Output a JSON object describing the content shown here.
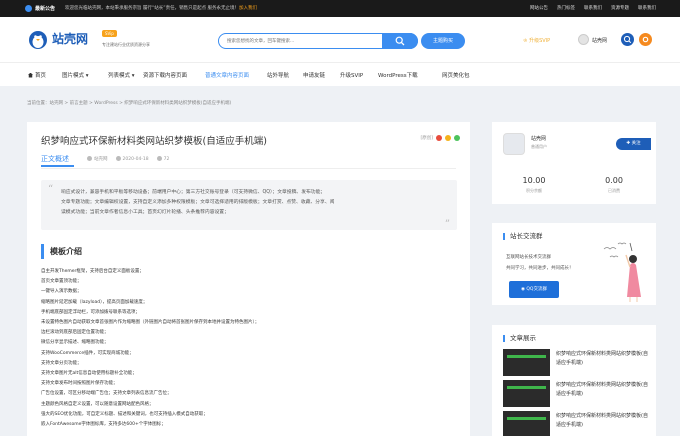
{
  "topbar": {
    "latest": "最新公告",
    "notice": "欢迎您光临站壳网，本站秉承服务宗旨 履行“站长”责任，销售只是起点 服务永无止境！",
    "notice_link": "加入我们",
    "links": [
      "网站公告",
      "热门标签",
      "联系我们",
      "资源专题",
      "联系我们"
    ]
  },
  "header": {
    "logo_text": "站壳网",
    "logo_badge": "SVip",
    "logo_sub": "专注建站行业优质资源分享",
    "search_placeholder": "搜索您想找的文章，回车键搜索...",
    "buy_button": "主题购买",
    "vip_label": "升级SVIP",
    "user_name": "站壳网"
  },
  "nav": {
    "items": [
      "首页",
      "图片模式",
      "列表模式",
      "资源下载内容页面",
      "普通文章内容页面",
      "站外导航",
      "申请友链",
      "升级SVIP",
      "WordPress下载",
      "网页美化包"
    ],
    "active_index": 4
  },
  "breadcrumb": "当前位置：站壳网 > 前言主题 > WordPress > 织梦响应式环保新材料类网站织梦模板(自适应手机端)",
  "article": {
    "title": "织梦响应式环保新材料类网站织梦模板(自适应手机端)",
    "badge": "[原创]",
    "tab": "正文概述",
    "author": "站壳网",
    "date": "2020-04-18",
    "views": "72",
    "quote_text_parts": [
      "响应式设计，兼容手机和平板等移动设备；前端用户中心；第三方社交账号登录（可支持微信、QQ）；文章投稿、发布功能；",
      "文章专题功能；文章编辑权设置，支持自定义添加多种权限模板；文章可选择适用的排版模板；文章打赏、点赞、收藏、分享、阅",
      "读模式功能；当前文章作者信息小工具；首页幻灯片轮播、头条推荐内容设置；"
    ],
    "section_title": "模板介绍",
    "lines": [
      "自主开发Themer框架，支持后台自定义面板设置；",
      "首页文章置顶功能；",
      "一键导入演示数据；",
      "缩略图片延迟加载（lazyload），提高页面加载速度；",
      "手机端底部固定浮动栏，可添加拨号联系等选项；",
      "未设置特色图片自动获取文章首张图片作为缩略图（外链图片自动将首张图片保存到本地并设置为特色图片）；",
      "边栏滚动到底部后固定位置功能；",
      "微信分享显示描述、缩略图功能；",
      "支持WooCommerce插件，可实现商城功能；",
      "支持文章分页功能；",
      "支持文章图片无alt信息自动使用标题补全功能；",
      "支持文章发布时间按照图片保存功能；",
      "广告位设置，可区分移动端广告位；支持文章列表信息流广告位；",
      "主题颜色风格自定义设置，可以随意设置网站配色风格；",
      "强大的SEO优化功能，可自定义标题、描述和关键词，也可支持插入模式自动获取；",
      "嵌入FontAwesome字体图标库，支持多达600+个字体图标；"
    ]
  },
  "sidebar": {
    "profile": {
      "name": "站壳网",
      "role": "普通用户",
      "follow": "关注",
      "stats": [
        {
          "num": "10.00",
          "label": "积分余额"
        },
        {
          "num": "0.00",
          "label": "已消费"
        }
      ]
    },
    "group": {
      "title": "站长交流群",
      "line1": "互联网站长技术交流群",
      "line2": "共同学习，共同进步，共同成长！",
      "qq_button": "QQ交流群"
    },
    "works": {
      "title": "文章展示",
      "items": [
        "织梦响应式环保新材料类网站织梦模板(自适应手机端)",
        "织梦响应式环保新材料类网站织梦模板(自适应手机端)",
        "织梦响应式环保新材料类网站织梦模板(自适应手机端)"
      ]
    }
  },
  "colors": {
    "accent": "#3b8df0",
    "brand": "#1e5eb8",
    "orange": "#f58a1f",
    "dot_red": "#e84c3d",
    "dot_yellow": "#f5b21b",
    "dot_green": "#4cc35c"
  }
}
